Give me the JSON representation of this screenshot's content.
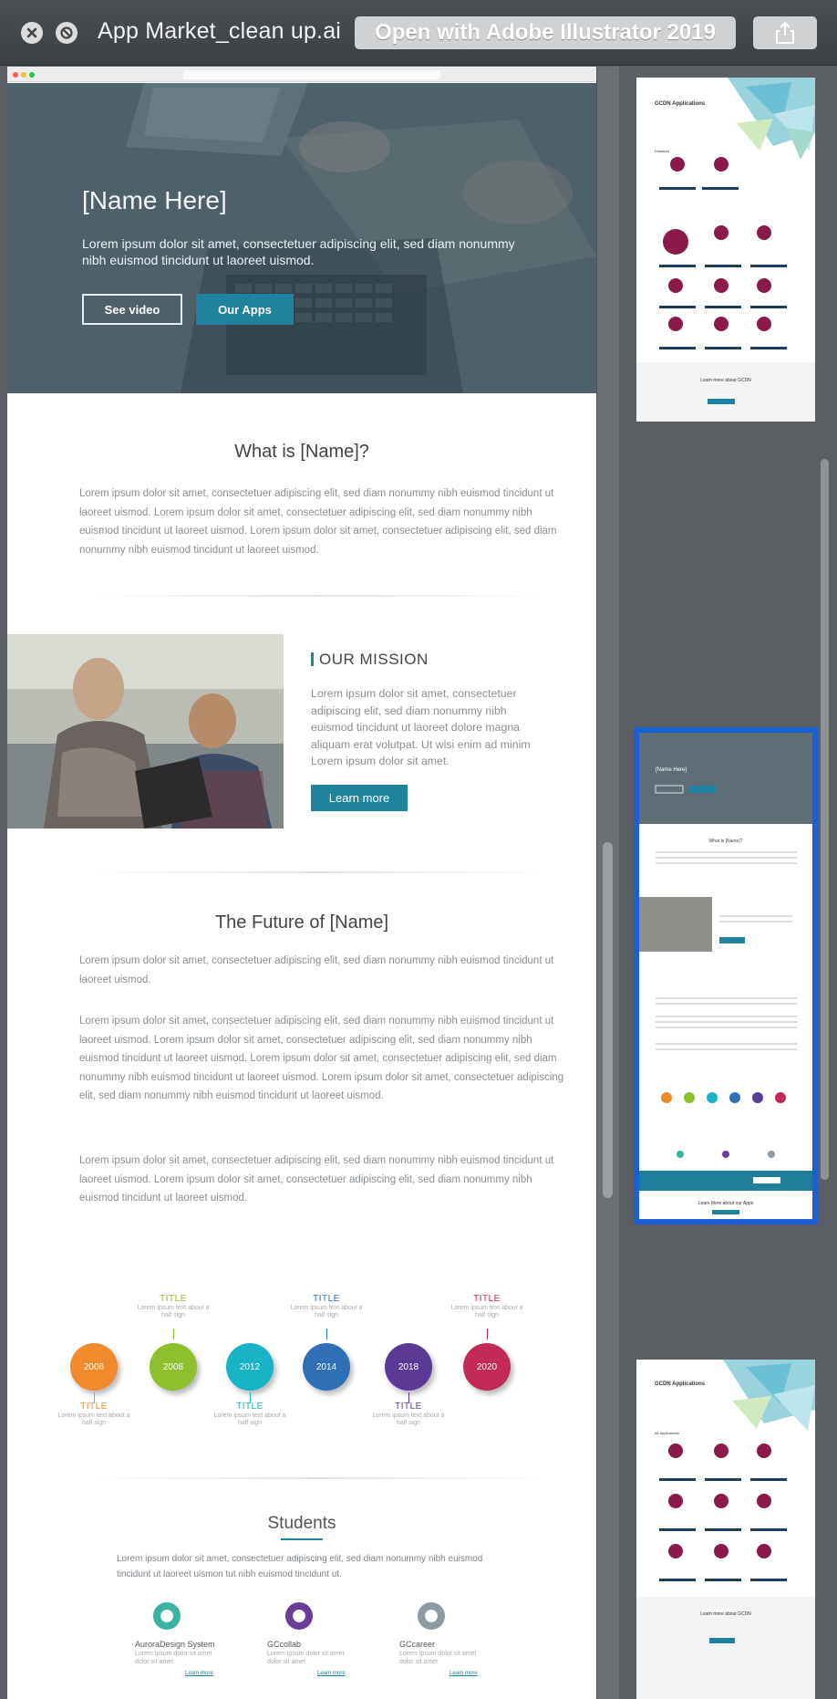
{
  "window": {
    "title": "App Market_clean up.ai",
    "open_with_label": "Open with Adobe Illustrator 2019"
  },
  "hero": {
    "title": "[Name Here]",
    "text": "Lorem ipsum dolor sit amet, consectetuer adipiscing elit, sed diam nonummy nibh euismod tincidunt ut laoreet uismod.",
    "see_video": "See video",
    "our_apps": "Our Apps"
  },
  "what_is": {
    "title": "What is [Name]?",
    "text": "Lorem ipsum dolor sit amet, consectetuer adipiscing elit, sed diam nonummy nibh euismod tincidunt ut laoreet uismod. Lorem ipsum dolor sit amet, consectetuer adipiscing elit, sed diam nonummy nibh euismod tincidunt ut laoreet uismod. Lorem ipsum dolor sit amet, consectetuer adipiscing elit, sed diam nonummy nibh euismod tincidunt ut laoreet uismod."
  },
  "mission": {
    "title": "OUR MISSION",
    "text": "Lorem ipsum dolor sit amet, consectetuer adipiscing elit, sed diam nonummy nibh euismod tincidunt ut laoreet dolore magna aliquam erat volutpat. Ut wisi enim ad minim Lorem ipsum dolor sit amet.",
    "button": "Learn more"
  },
  "future": {
    "title": "The Future of [Name]",
    "p1": "Lorem ipsum dolor sit amet, consectetuer adipiscing elit, sed diam nonummy nibh euismod tincidunt ut laoreet uismod.",
    "p2": "Lorem ipsum dolor sit amet, consectetuer adipiscing elit, sed diam nonummy nibh euismod tincidunt ut laoreet uismod. Lorem ipsum dolor sit amet, consectetuer adipiscing elit, sed diam nonummy nibh euismod tincidunt ut laoreet uismod. Lorem ipsum dolor sit amet, consectetuer adipiscing elit, sed diam nonummy nibh euismod tincidunt ut laoreet uismod. Lorem ipsum dolor sit amet, consectetuer adipiscing elit, sed diam nonummy nibh euismod tincidunt ut laoreet uismod.",
    "p3": "Lorem ipsum dolor sit amet, consectetuer adipiscing elit, sed diam nonummy nibh euismod tincidunt ut laoreet uismod. Lorem ipsum dolor sit amet, consectetuer adipiscing elit, sed diam nonummy nibh euismod tincidunt ut laoreet uismod."
  },
  "timeline": {
    "years": [
      "2006",
      "2008",
      "2012",
      "2014",
      "2018",
      "2020"
    ],
    "colors": [
      "#f08a2c",
      "#8dbf2e",
      "#19b3c8",
      "#2e6fb5",
      "#5b3a97",
      "#c22a57"
    ],
    "label": "TITLE",
    "sub": "Lorem ipsum text about a half sign",
    "top_label_colors": [
      "#8dbf2e",
      "#2e6fb5",
      "#c22a57"
    ],
    "bottom_label_colors": [
      "#f08a2c",
      "#19b3c8",
      "#5b3a97"
    ]
  },
  "students": {
    "title": "Students",
    "text": "Lorem ipsum dolor sit amet, consectetuer adipiscing elit, sed diam nonummy nibh euismod tincidunt ut laoreet uismon tut nibh euismod tincidunt ut.",
    "apps": [
      {
        "name": "AuroraDesign System",
        "desc": "Lorem ipsum dolor sit amet dolor sit amet",
        "link": "Learn more",
        "color": "#3bb3a0",
        "icon": "aurora-logo-icon"
      },
      {
        "name": "GCcollab",
        "desc": "Lorem ipsum dolor sit amet dolor sit amet",
        "link": "Learn more",
        "color": "#6a3d9a",
        "icon": "gccollab-logo-icon"
      },
      {
        "name": "GCcareer",
        "desc": "Lorem ipsum dolor sit amet dolor sit amet",
        "link": "Learn more",
        "color": "#8c9aa3",
        "icon": "gccareer-logo-icon"
      }
    ]
  },
  "thumbnails": [
    {
      "title": "GCDN Applications",
      "section": "Featured",
      "footer": "Learn more about GCDN",
      "selected": false
    },
    {
      "title": "[Name Here]",
      "section": "What is [Name]?",
      "footer": "Learn More about our Apps",
      "selected": true
    },
    {
      "title": "GCDN Applications",
      "section": "All Applications",
      "footer": "Learn more about GCDN",
      "selected": false
    }
  ]
}
